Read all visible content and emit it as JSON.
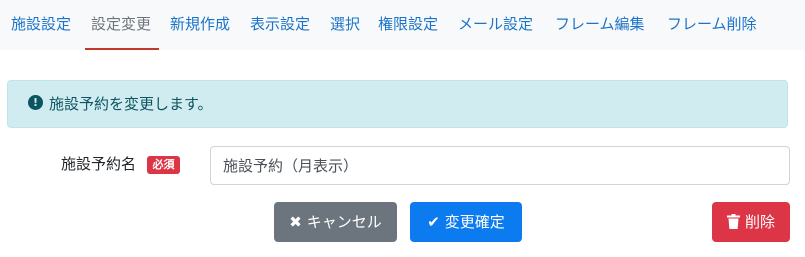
{
  "tabs": [
    {
      "label": "施設設定",
      "active": false
    },
    {
      "label": "設定変更",
      "active": true
    },
    {
      "label": "新規作成",
      "active": false
    },
    {
      "label": "表示設定",
      "active": false
    },
    {
      "label": "選択",
      "active": false
    },
    {
      "label": "権限設定",
      "active": false
    },
    {
      "label": "メール設定",
      "active": false
    },
    {
      "label": "フレーム編集",
      "active": false
    },
    {
      "label": "フレーム削除",
      "active": false
    }
  ],
  "alert": {
    "icon": "exclamation-circle-icon",
    "message": "施設予約を変更します。"
  },
  "form": {
    "name_label": "施設予約名",
    "required_badge": "必須",
    "name_value": "施設予約（月表示）"
  },
  "buttons": {
    "cancel_label": "キャンセル",
    "cancel_icon": "times-icon",
    "confirm_label": "変更確定",
    "confirm_icon": "check-icon",
    "delete_label": "削除",
    "delete_icon": "trash-icon"
  },
  "colors": {
    "tab_link": "#1a73c9",
    "tab_active": "#6c757d",
    "tab_active_underline": "#c0392b",
    "alert_bg": "#d1ecf1",
    "alert_text": "#0c5460",
    "badge_bg": "#dc3545",
    "cancel_bg": "#6c757d",
    "confirm_bg": "#0d7bf0",
    "delete_bg": "#dc3545"
  }
}
